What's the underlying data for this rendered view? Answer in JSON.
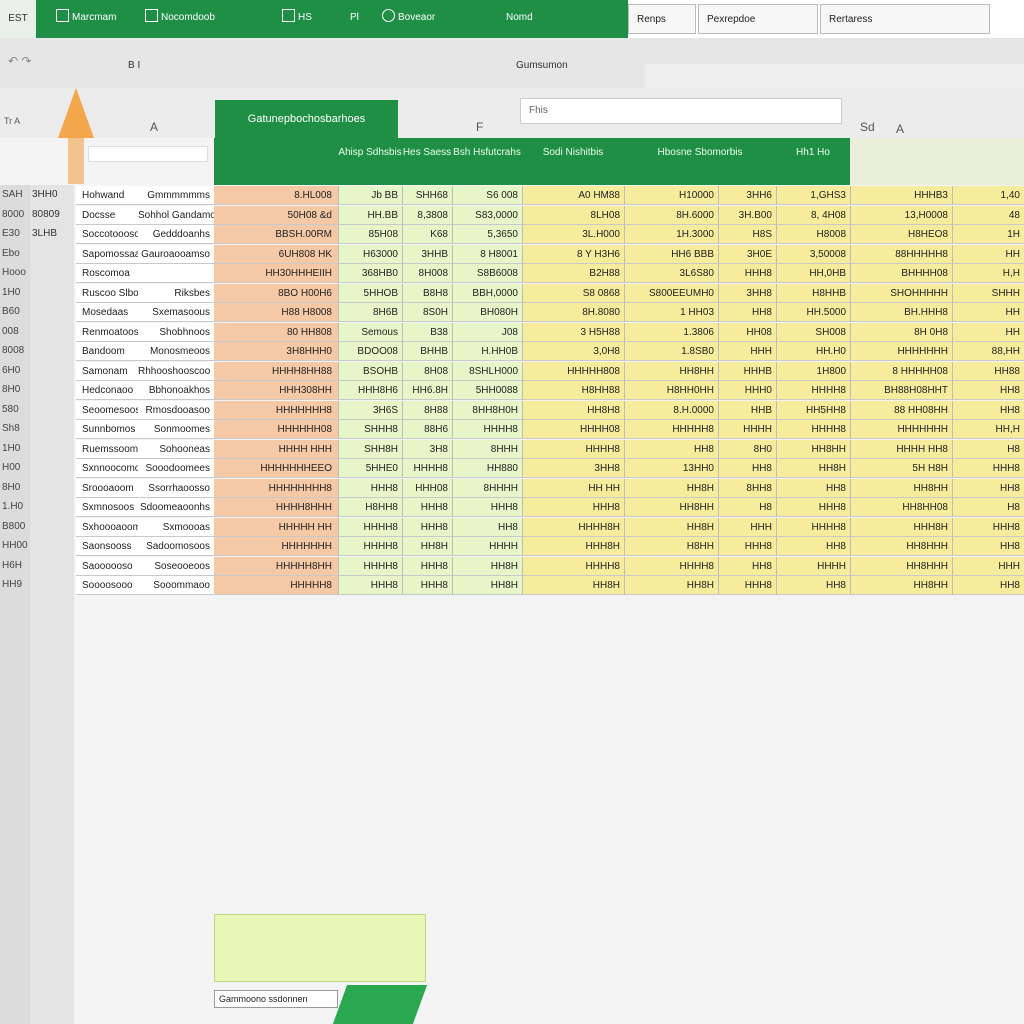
{
  "ribbon": {
    "file": "EST",
    "buttons": [
      "Marcmam",
      "Nocomdoob",
      "HS",
      "Pl",
      "Boveaor",
      "Nomd"
    ]
  },
  "top_tabs": [
    "Renps",
    "Pexrepdoe",
    "Rertaress"
  ],
  "toolbar": {
    "undo": "↶ ↷",
    "bold": "B I",
    "name": "Gumsumon"
  },
  "formula_bar": {
    "value": "Fhis"
  },
  "columns": {
    "a": "A",
    "b": "F",
    "c": "Sd",
    "d": "A"
  },
  "left_label": "Tr A",
  "title_cell": "Gatunepbochosbarhoes",
  "headers": [
    "Ahisp Sdhsbis",
    "Hes Saess",
    "Bsh Hsfutcrahs",
    "Sodi Nishitbis",
    "Hbosne Sbomorbis",
    "Hh1 Ho"
  ],
  "rows": [
    {
      "h": "SAH",
      "n": "3HH0",
      "a": "Hohwand",
      "b": "Gmmmmmms",
      "amt": "8.HL008",
      "g1": "Jb BB",
      "g2": "SHH68",
      "g3": "S6 008",
      "y1": "A0 HM88",
      "y2": "H10000",
      "y3": "3HH6",
      "y4": "1,GHS3",
      "y5": "HHHB3",
      "y6": "1,40"
    },
    {
      "h": "8000",
      "n": "80809",
      "a": "Docsse",
      "b": "Sohhol Gandamo",
      "amt": "50H08 &d",
      "g1": "HH.BB",
      "g2": "8,3808",
      "g3": "S83,0000",
      "y1": "8LH08",
      "y2": "8H.6000",
      "y3": "3H.B00",
      "y4": "8, 4H08",
      "y5": "13,H0008",
      "y6": "48"
    },
    {
      "h": "E30",
      "n": "3LHB",
      "a": "Soccotooosoobas",
      "b": "Gedddoanhs",
      "amt": "BBSH.00RM",
      "g1": "85H08",
      "g2": "K68",
      "g3": "5,3650",
      "y1": "3L.H000",
      "y2": "1H.3000",
      "y3": "H8S",
      "y4": "H8008",
      "y5": "H8HEO8",
      "y6": "1H"
    },
    {
      "h": "Ebo",
      "n": "",
      "a": "Sapomossaa",
      "b": "Gauroaooamso",
      "amt": "6UH808 HK",
      "g1": "H63000",
      "g2": "3HHB",
      "g3": "8 H8001",
      "y1": "8 Y H3H6",
      "y2": "HH6 BBB",
      "y3": "3H0E",
      "y4": "3,50008",
      "y5": "88HHHHH8",
      "y6": "HH"
    },
    {
      "h": "Hooo",
      "n": "",
      "a": "Roscomoa",
      "b": "",
      "amt": "HH30HHHEIIH",
      "g1": "368HB0",
      "g2": "8H008",
      "g3": "S8B6008",
      "y1": "B2H88",
      "y2": "3L6S80",
      "y3": "HHH8",
      "y4": "HH,0HB",
      "y5": "BHHHH08",
      "y6": "H,H"
    },
    {
      "h": "1H0",
      "n": "",
      "a": "Ruscoo Slbon",
      "b": "Riksbes",
      "amt": "8BO H00H6",
      "g1": "5HHOB",
      "g2": "B8H8",
      "g3": "BBH,0000",
      "y1": "S8 0868",
      "y2": "S800EEUMH0",
      "y3": "3HH8",
      "y4": "H8HHB",
      "y5": "SHOHHHHH",
      "y6": "SHHH"
    },
    {
      "h": "B60",
      "n": "",
      "a": "Mosedaas",
      "b": "Sxemasoous",
      "amt": "H88 H8008",
      "g1": "8H6B",
      "g2": "8S0H",
      "g3": "BH080H",
      "y1": "8H.8080",
      "y2": "1 HH03",
      "y3": "HH8",
      "y4": "HH.5000",
      "y5": "BH.HHH8",
      "y6": "HH"
    },
    {
      "h": "008",
      "n": "",
      "a": "Renmoatoos",
      "b": "Shobhnoos",
      "amt": "80 HH808",
      "g1": "Semous",
      "g2": "B38",
      "g3": "J08",
      "y1": "3 H5H88",
      "y2": "1.3806",
      "y3": "HH08",
      "y4": "SH008",
      "y5": "8H 0H8",
      "y6": "HH"
    },
    {
      "h": "8008",
      "n": "",
      "a": "Bandoom",
      "b": "Monosmeoos",
      "amt": "3H8HHH0",
      "g1": "BDOO08",
      "g2": "BHHB",
      "g3": "H.HH0B",
      "y1": "3,0H8",
      "y2": "1.8SB0",
      "y3": "HHH",
      "y4": "HH.H0",
      "y5": "HHHHHHH",
      "y6": "88,HH"
    },
    {
      "h": "6H0",
      "n": "",
      "a": "Samonam",
      "b": "Rhhooshooscoo",
      "amt": "HHHH8HH88",
      "g1": "BSOHB",
      "g2": "8H08",
      "g3": "8SHLH000",
      "y1": "HHHHH808",
      "y2": "HH8HH",
      "y3": "HHHB",
      "y4": "1H800",
      "y5": "8 HHHHH08",
      "y6": "HH88"
    },
    {
      "h": "8H0",
      "n": "",
      "a": "Hedconaoo",
      "b": "Bbhonoakhos",
      "amt": "HHH308HH",
      "g1": "HHH8H6",
      "g2": "HH6.8H",
      "g3": "5HH0088",
      "y1": "H8HH88",
      "y2": "H8HH0HH",
      "y3": "HHH0",
      "y4": "HHHH8",
      "y5": "BH88H08HHT",
      "y6": "HH8"
    },
    {
      "h": "580",
      "n": "",
      "a": "Seoomesoos",
      "b": "Rmosdooasoo",
      "amt": "HHHHHHH8",
      "g1": "3H6S",
      "g2": "8H88",
      "g3": "8HH8H0H",
      "y1": "HH8H8",
      "y2": "8.H.0000",
      "y3": "HHB",
      "y4": "HH5HH8",
      "y5": "88 HH08HH",
      "y6": "HH8"
    },
    {
      "h": "Sh8",
      "n": "",
      "a": "Sunnbomos",
      "b": "Sonmoomes",
      "amt": "HHHHHH08",
      "g1": "SHHH8",
      "g2": "88H6",
      "g3": "HHHH8",
      "y1": "HHHH08",
      "y2": "HHHHH8",
      "y3": "HHHH",
      "y4": "HHHH8",
      "y5": "HHHHHHH",
      "y6": "HH,H"
    },
    {
      "h": "1H0",
      "n": "",
      "a": "Ruemssoom",
      "b": "Sohooneas",
      "amt": "HHHH HHH",
      "g1": "SHH8H",
      "g2": "3H8",
      "g3": "8HHH",
      "y1": "HHHH8",
      "y2": "HH8",
      "y3": "8H0",
      "y4": "HH8HH",
      "y5": "HHHH HH8",
      "y6": "H8"
    },
    {
      "h": "H00",
      "n": "",
      "a": "Sxnnoocomoe",
      "b": "Sooodoomees",
      "amt": "HHHHHHHEEO",
      "g1": "5HHE0",
      "g2": "HHHH8",
      "g3": "HH880",
      "y1": "3HH8",
      "y2": "13HH0",
      "y3": "HH8",
      "y4": "HH8H",
      "y5": "5H H8H",
      "y6": "HHH8"
    },
    {
      "h": "8H0",
      "n": "",
      "a": "Sroooaoom",
      "b": "Ssorrhaoosso",
      "amt": "HHHHHHHH8",
      "g1": "HHH8",
      "g2": "HHH08",
      "g3": "8HHHH",
      "y1": "HH HH",
      "y2": "HH8H",
      "y3": "8HH8",
      "y4": "HH8",
      "y5": "HH8HH",
      "y6": "HH8"
    },
    {
      "h": "1.H0",
      "n": "",
      "a": "Sxmnosoos",
      "b": "Sdoomeaoonhs",
      "amt": "HHHH8HHH",
      "g1": "H8HH8",
      "g2": "HHH8",
      "g3": "HHH8",
      "y1": "HHH8",
      "y2": "HH8HH",
      "y3": "H8",
      "y4": "HHH8",
      "y5": "HH8HH08",
      "y6": "H8"
    },
    {
      "h": "B800",
      "n": "",
      "a": "Sxhoooaoom",
      "b": "Sxmoooas",
      "amt": "HHHHH HH",
      "g1": "HHHH8",
      "g2": "HHH8",
      "g3": "HH8",
      "y1": "HHHH8H",
      "y2": "HH8H",
      "y3": "HHH",
      "y4": "HHHH8",
      "y5": "HHH8H",
      "y6": "HHH8"
    },
    {
      "h": "HH00",
      "n": "",
      "a": "Saonsooss",
      "b": "Sadoomosoos",
      "amt": "HHHHHHH",
      "g1": "HHHH8",
      "g2": "HH8H",
      "g3": "HHHH",
      "y1": "HHH8H",
      "y2": "H8HH",
      "y3": "HHH8",
      "y4": "HH8",
      "y5": "HH8HHH",
      "y6": "HH8"
    },
    {
      "h": "H6H",
      "n": "",
      "a": "Saoooooso",
      "b": "Soseooeoos",
      "amt": "HHHHH8HH",
      "g1": "HHHH8",
      "g2": "HHH8",
      "g3": "HH8H",
      "y1": "HHHH8",
      "y2": "HHHH8",
      "y3": "HH8",
      "y4": "HHHH",
      "y5": "HH8HHH",
      "y6": "HHH"
    },
    {
      "h": "HH9",
      "n": "",
      "a": "Soooosooo",
      "b": "Sooommaoo",
      "amt": "HHHHH8",
      "g1": "HHH8",
      "g2": "HHH8",
      "g3": "HH8H",
      "y1": "HH8H",
      "y2": "HH8H",
      "y3": "HHH8",
      "y4": "HH8",
      "y5": "HH8HH",
      "y6": "HH8"
    }
  ],
  "bottom_label": "Gammoono ssdonnen"
}
